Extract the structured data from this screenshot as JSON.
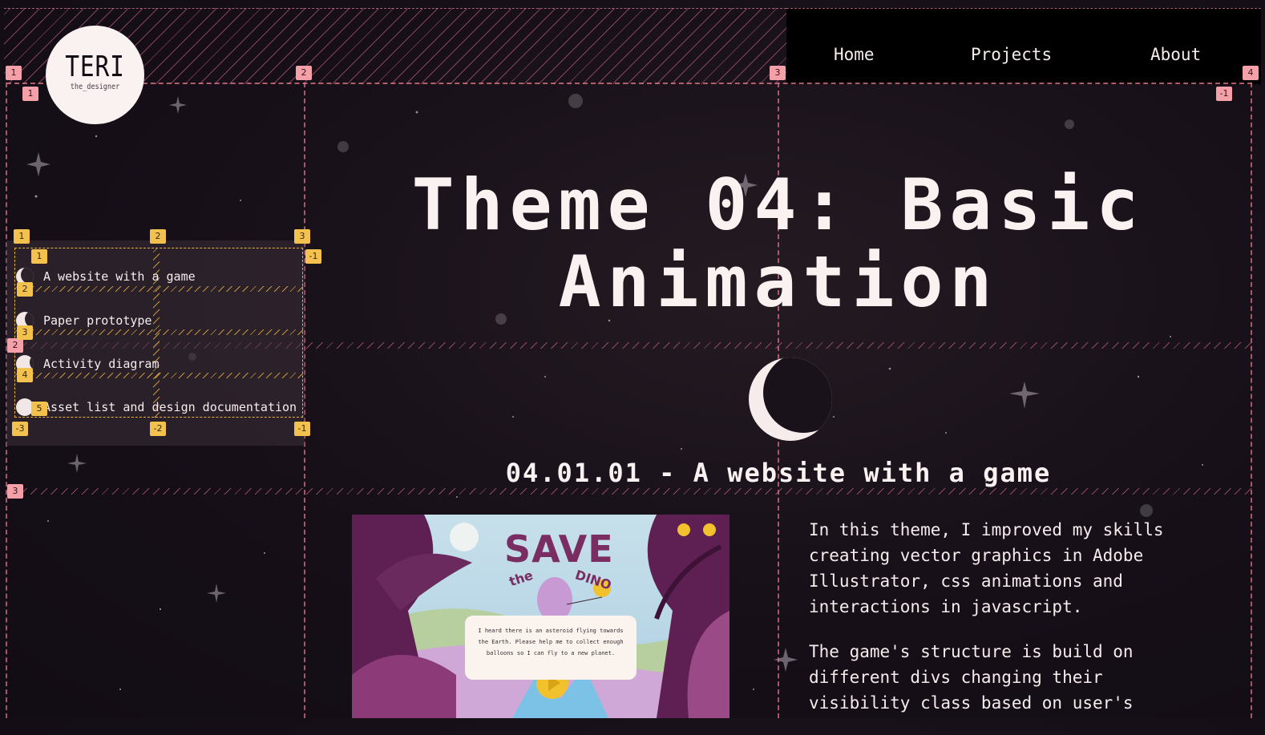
{
  "brand": {
    "name": "TERI",
    "tagline": "the_designer"
  },
  "nav": {
    "items": [
      "Home",
      "Projects",
      "About"
    ]
  },
  "sidebar": {
    "items": [
      {
        "label": "A website with a game"
      },
      {
        "label": "Paper prototype"
      },
      {
        "label": "Activity diagram"
      },
      {
        "label": "Asset list and design documentation"
      }
    ]
  },
  "main": {
    "title": "Theme 04: Basic Animation",
    "section_title": "04.01.01 - A website with a game",
    "paragraphs": [
      "In this theme, I improved my skills creating vector graphics in Adobe Illustrator, css animations and interactions in javascript.",
      "The game's structure is build on different divs changing their visibility class based on user's"
    ]
  },
  "game_preview": {
    "title": "SAVE",
    "the": "the",
    "dino": "DINO",
    "dialog": "I heard there is an asteroid flying towards the Earth. Please help me to collect enough balloons so I can fly to a new planet."
  },
  "overlay": {
    "pink_badges": [
      "1",
      "2",
      "3",
      "4",
      "1",
      "-1",
      "2",
      "3"
    ],
    "yellow_badges": [
      "1",
      "2",
      "3",
      "-1",
      "1",
      "2",
      "3",
      "4",
      "5",
      "-3",
      "-2",
      "-1"
    ]
  },
  "colors": {
    "background": "#160f18",
    "text": "#f6ecec",
    "grid_pink": "#e6788c",
    "grid_yellow": "#e9b13c",
    "game_purple": "#7a2d63"
  }
}
